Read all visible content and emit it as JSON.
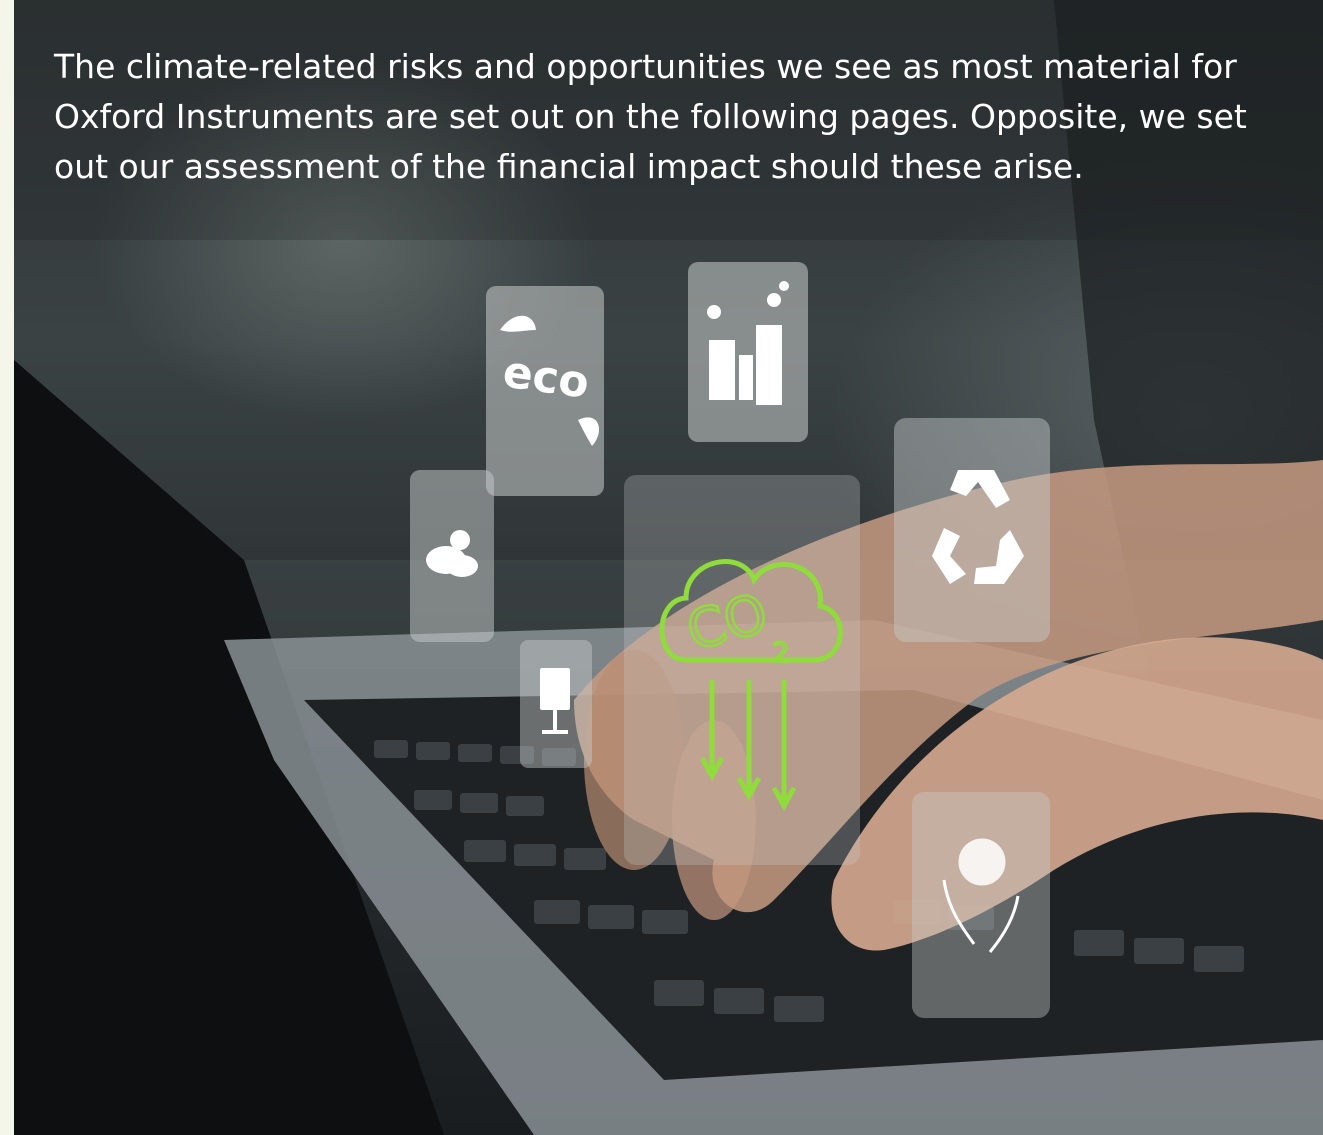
{
  "intro_text": "The climate-related risks and opportunities we see as most material for Oxford Instruments are set out on the following pages. Opposite, we set out our assessment of the financial impact should these arise.",
  "image": {
    "tile_labels": {
      "eco": "eco",
      "co2_main": "CO",
      "co2_sub": "2"
    },
    "icons": [
      "eco-leaf-icon",
      "factory-emissions-icon",
      "weather-cloud-sun-icon",
      "co2-cloud-icon",
      "recycle-icon",
      "solar-panel-icon",
      "hands-globe-icon"
    ],
    "colors": {
      "co2_green": "#8fdc3c",
      "tile_fill": "#c8cccb"
    }
  }
}
